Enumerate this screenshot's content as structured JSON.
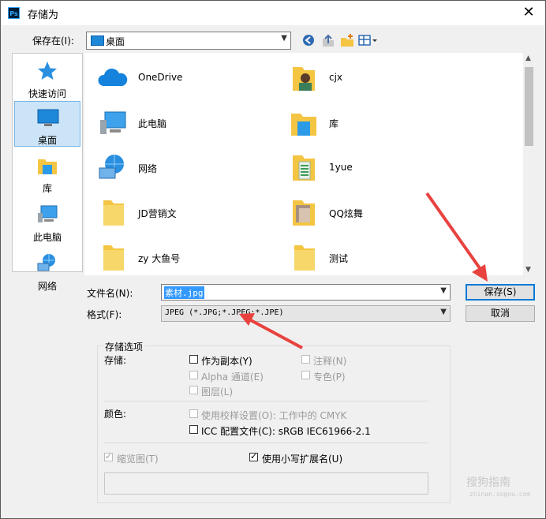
{
  "window": {
    "title": "存储为",
    "app_badge": "Ps"
  },
  "save_in": {
    "label": "保存在(I):",
    "value": "桌面"
  },
  "sidebar": {
    "items": [
      {
        "label": "快速访问",
        "icon": "star-icon"
      },
      {
        "label": "桌面",
        "icon": "desktop-icon",
        "selected": true
      },
      {
        "label": "库",
        "icon": "library-icon"
      },
      {
        "label": "此电脑",
        "icon": "computer-icon"
      },
      {
        "label": "网络",
        "icon": "network-icon"
      }
    ]
  },
  "files": [
    {
      "name": "OneDrive",
      "icon": "onedrive-icon"
    },
    {
      "name": "cjx",
      "icon": "user-folder-icon"
    },
    {
      "name": "此电脑",
      "icon": "computer-icon"
    },
    {
      "name": "库",
      "icon": "library-icon"
    },
    {
      "name": "网络",
      "icon": "network-icon"
    },
    {
      "name": "1yue",
      "icon": "folder-icon"
    },
    {
      "name": "JD营销文",
      "icon": "folder-icon"
    },
    {
      "name": "QQ炫舞",
      "icon": "folder-icon"
    },
    {
      "name": "zy 大鱼号",
      "icon": "folder-icon"
    },
    {
      "name": "测试",
      "icon": "folder-icon"
    }
  ],
  "filename": {
    "label": "文件名(N):",
    "value": "素材.jpg"
  },
  "format": {
    "label": "格式(F):",
    "value": "JPEG (*.JPG;*.JPEG;*.JPE)"
  },
  "buttons": {
    "save": "保存(S)",
    "cancel": "取消"
  },
  "options": {
    "group_title": "存储选项",
    "storage_label": "存储:",
    "as_copy": "作为副本(Y)",
    "notes": "注释(N)",
    "alpha": "Alpha 通道(E)",
    "spot": "专色(P)",
    "layers": "图层(L)",
    "color_label": "颜色:",
    "proof": "使用校样设置(O):  工作中的 CMYK",
    "icc": "ICC 配置文件(C):  sRGB IEC61966-2.1",
    "thumbnail": "缩览图(T)",
    "lowercase_ext": "使用小写扩展名(U)"
  },
  "watermark": {
    "text": "搜狗指南",
    "sub": "zhinan.sogou.com"
  },
  "colors": {
    "accent": "#0078d7",
    "selection": "#3399ff",
    "arrow": "#e8423f"
  }
}
